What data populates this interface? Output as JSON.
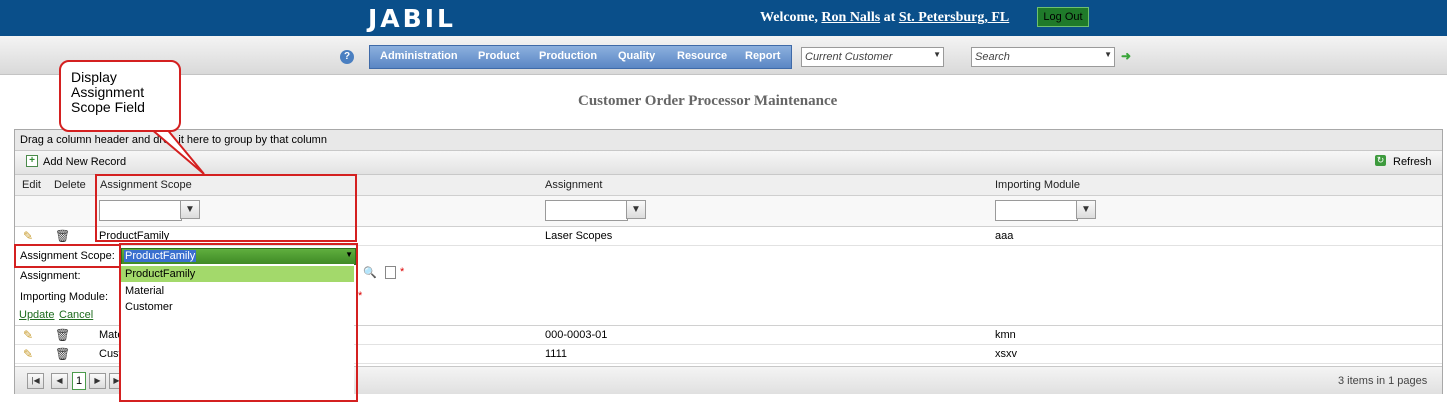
{
  "header": {
    "logo": "JABIL",
    "welcome": "Welcome,",
    "user": "Ron Nalls",
    "at": "at",
    "location": "St. Petersburg, FL",
    "logout": "Log Out"
  },
  "nav": {
    "help": "?",
    "menu": [
      "Administration",
      "Product",
      "Production",
      "Quality",
      "Resource",
      "Report"
    ],
    "customer_select": "Current Customer",
    "search_select": "Search",
    "go_icon": "arrow-right-icon"
  },
  "page": {
    "title": "Customer Order Processor Maintenance"
  },
  "callout": {
    "text": "Display Assignment Scope Field"
  },
  "grid": {
    "group_hint": "Drag a column header and drop it here to group by that column",
    "add_new": "Add New Record",
    "refresh": "Refresh",
    "columns": [
      "Edit",
      "Delete",
      "Assignment Scope",
      "Assignment",
      "Importing Module"
    ],
    "rows": [
      {
        "scope": "ProductFamily",
        "assignment": "Laser Scopes",
        "module": "aaa"
      },
      {
        "scope": "Material",
        "assignment": "000-0003-01",
        "module": "kmn"
      },
      {
        "scope": "Customer",
        "assignment": "1111",
        "module": "xsxv"
      }
    ],
    "edit_form": {
      "scope_label": "Assignment Scope:",
      "assignment_label": "Assignment:",
      "module_label": "Importing Module:",
      "update": "Update",
      "cancel": "Cancel",
      "required": "*"
    },
    "scope_combo": {
      "value": "ProductFamily",
      "options": [
        "ProductFamily",
        "Material",
        "Customer"
      ],
      "selected": 0
    },
    "pager": {
      "current_page": "1",
      "info": "3 items in 1 pages"
    }
  },
  "colors": {
    "header_blue": "#0a4f8a",
    "annotation_red": "#d42020",
    "selected_option": "#a3d96b"
  }
}
